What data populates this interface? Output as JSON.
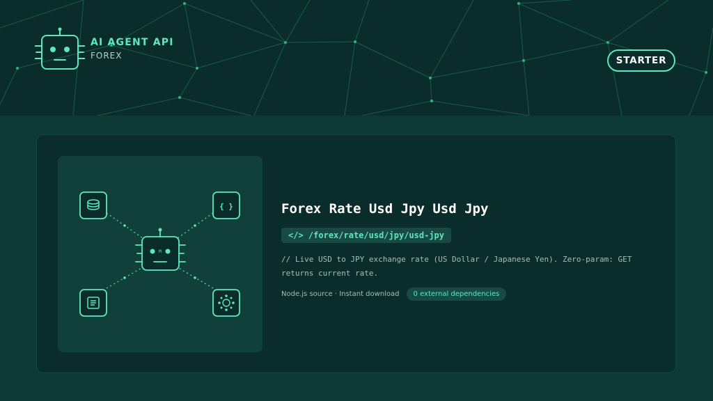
{
  "brand": {
    "title": "AI AGENT API",
    "subtitle": "FOREX",
    "icon": "robot-icon"
  },
  "header": {
    "starter_label": "STARTER"
  },
  "card": {
    "title": "Forex Rate Usd Jpy Usd Jpy",
    "endpoint_prefix": "</>",
    "endpoint_path": "/forex/rate/usd/jpy/usd-jpy",
    "description": "// Live USD to JPY exchange rate (US Dollar / Japanese Yen). Zero-param: GET returns current rate.",
    "meta": "Node.js source · Instant download",
    "badge": "0 external dependencies",
    "diagram_icons": [
      "database-icon",
      "code-braces-icon",
      "robot-icon",
      "document-icon",
      "network-hub-icon"
    ],
    "diagram_label": "{ }"
  },
  "colors": {
    "accent": "#5fe6c3",
    "header_bg": "#0a2d2b",
    "page_bg": "#0d3a36"
  }
}
